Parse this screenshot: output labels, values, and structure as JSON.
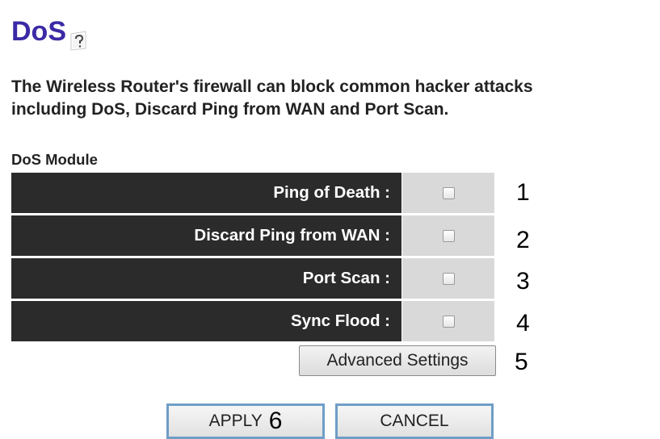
{
  "header": {
    "title": "DoS",
    "help_icon": "help-question-icon"
  },
  "description": {
    "line1": "The Wireless Router's firewall can block common hacker attacks",
    "line2": "including DoS, Discard Ping from WAN and Port Scan."
  },
  "module": {
    "label": "DoS Module",
    "rows": [
      {
        "label": "Ping of Death :",
        "checked": false,
        "annotation": "1"
      },
      {
        "label": "Discard Ping from WAN :",
        "checked": false,
        "annotation": "2"
      },
      {
        "label": "Port Scan :",
        "checked": false,
        "annotation": "3"
      },
      {
        "label": "Sync Flood :",
        "checked": false,
        "annotation": "4"
      }
    ]
  },
  "advanced": {
    "label": "Advanced Settings",
    "annotation": "5"
  },
  "actions": {
    "apply_label": "APPLY",
    "apply_annotation": "6",
    "cancel_label": "CANCEL"
  }
}
